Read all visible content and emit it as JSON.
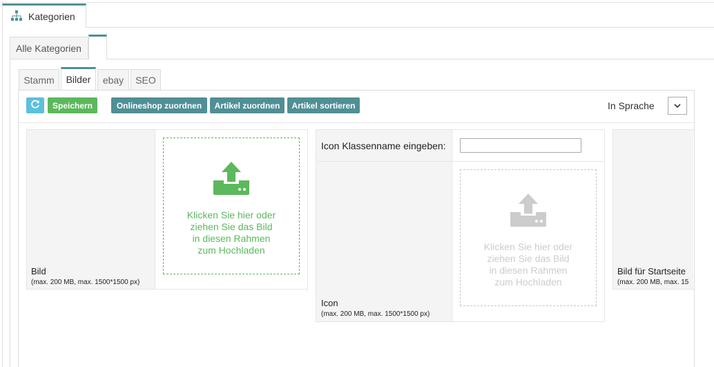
{
  "main_tab": {
    "label": "Kategorien",
    "icon": "sitemap-icon"
  },
  "level2_tabs": [
    {
      "label": "Alle Kategorien",
      "active": false
    },
    {
      "label": "",
      "active": true
    }
  ],
  "level3_tabs": [
    {
      "label": "Stamm",
      "active": false
    },
    {
      "label": "Bilder",
      "active": true
    },
    {
      "label": "ebay",
      "active": false
    },
    {
      "label": "SEO",
      "active": false
    }
  ],
  "toolbar": {
    "refresh_icon": "refresh-icon",
    "save_label": "Speichern",
    "onlineshop_label": "Onlineshop zuordnen",
    "artikel_zuordnen_label": "Artikel zuordnen",
    "artikel_sortieren_label": "Artikel sortieren",
    "language_label": "In Sprache",
    "language_value": ""
  },
  "cards": {
    "bild": {
      "label": "Bild",
      "hint": "(max. 200 MB, max. 1500*1500 px)",
      "upload_text_1": "Klicken Sie hier oder",
      "upload_text_2": "ziehen Sie das Bild",
      "upload_text_3": "in diesen Rahmen",
      "upload_text_4": "zum Hochladen"
    },
    "icon": {
      "classname_label": "Icon Klassenname eingeben:",
      "classname_value": "",
      "label": "Icon",
      "hint": "(max. 200 MB, max. 1500*1500 px)",
      "upload_text_1": "Klicken Sie hier oder",
      "upload_text_2": "ziehen Sie das Bild",
      "upload_text_3": "in diesen Rahmen",
      "upload_text_4": "zum Hochladen"
    },
    "startseite": {
      "label": "Bild für Startseite",
      "hint": "(max. 200 MB, max. 15"
    }
  },
  "colors": {
    "accent": "#4f8f95",
    "save_green": "#5cb85c",
    "refresh_blue": "#5bc0de",
    "upload_green": "#5cb85c",
    "upload_gray": "#cccccc"
  }
}
